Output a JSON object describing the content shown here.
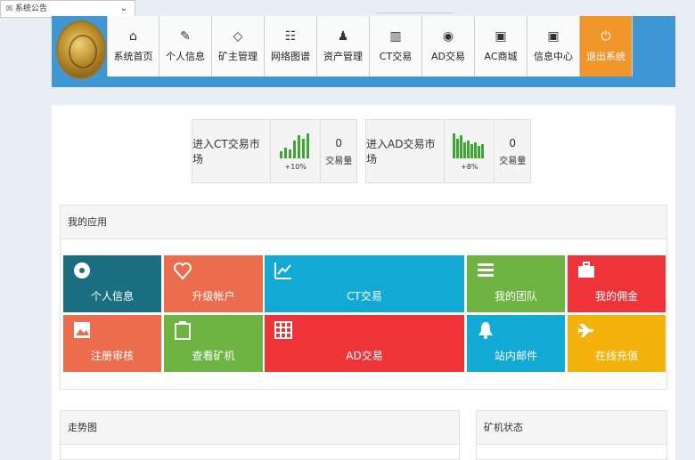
{
  "notice": {
    "label": "系统公告"
  },
  "nav": [
    {
      "label": "系统首页",
      "icon": "home-icon",
      "glyph": "⌂"
    },
    {
      "label": "个人信息",
      "icon": "edit-icon",
      "glyph": "✎"
    },
    {
      "label": "矿主管理",
      "icon": "diamond-icon",
      "glyph": "◇"
    },
    {
      "label": "网络图谱",
      "icon": "users-icon",
      "glyph": "☷"
    },
    {
      "label": "资产管理",
      "icon": "user-icon",
      "glyph": "♟"
    },
    {
      "label": "CT交易",
      "icon": "bar-chart-icon",
      "glyph": "▥"
    },
    {
      "label": "AD交易",
      "icon": "dashboard-icon",
      "glyph": "◉"
    },
    {
      "label": "AC商城",
      "icon": "calendar-icon",
      "glyph": "▣"
    },
    {
      "label": "信息中心",
      "icon": "calendar-icon",
      "glyph": "▣"
    },
    {
      "label": "退出系统",
      "icon": "power-icon",
      "glyph": "⏻"
    }
  ],
  "markets": [
    {
      "label": "进入CT交易市场",
      "change": "+10%",
      "volume": "0",
      "volume_label": "交易量",
      "color": "#3ea633"
    },
    {
      "label": "进入AD交易市场",
      "change": "+8%",
      "volume": "0",
      "volume_label": "交易量",
      "color": "#3ea633"
    }
  ],
  "apps": {
    "title": "我的应用",
    "tiles": [
      {
        "label": "个人信息",
        "icon": "dashboard-icon",
        "color": "#1b6f80"
      },
      {
        "label": "升级帐户",
        "icon": "heart-icon",
        "color": "#ec6d4e"
      },
      {
        "label": "CT交易",
        "icon": "line-chart-icon",
        "color": "#12a9d4"
      },
      {
        "label": "我的团队",
        "icon": "list-icon",
        "color": "#6db443"
      },
      {
        "label": "我的佣金",
        "icon": "briefcase-icon",
        "color": "#ee3439"
      },
      {
        "label": "注册审核",
        "icon": "picture-icon",
        "color": "#ec6d4e"
      },
      {
        "label": "查看矿机",
        "icon": "clipboard-icon",
        "color": "#6db443"
      },
      {
        "label": "AD交易",
        "icon": "grid-icon",
        "color": "#ee3439"
      },
      {
        "label": "站内邮件",
        "icon": "bell-icon",
        "color": "#12a9d4"
      },
      {
        "label": "在线充值",
        "icon": "plane-icon",
        "color": "#f3b30c"
      }
    ]
  },
  "panels": {
    "trend": "走势图",
    "miner_status": "矿机状态"
  }
}
